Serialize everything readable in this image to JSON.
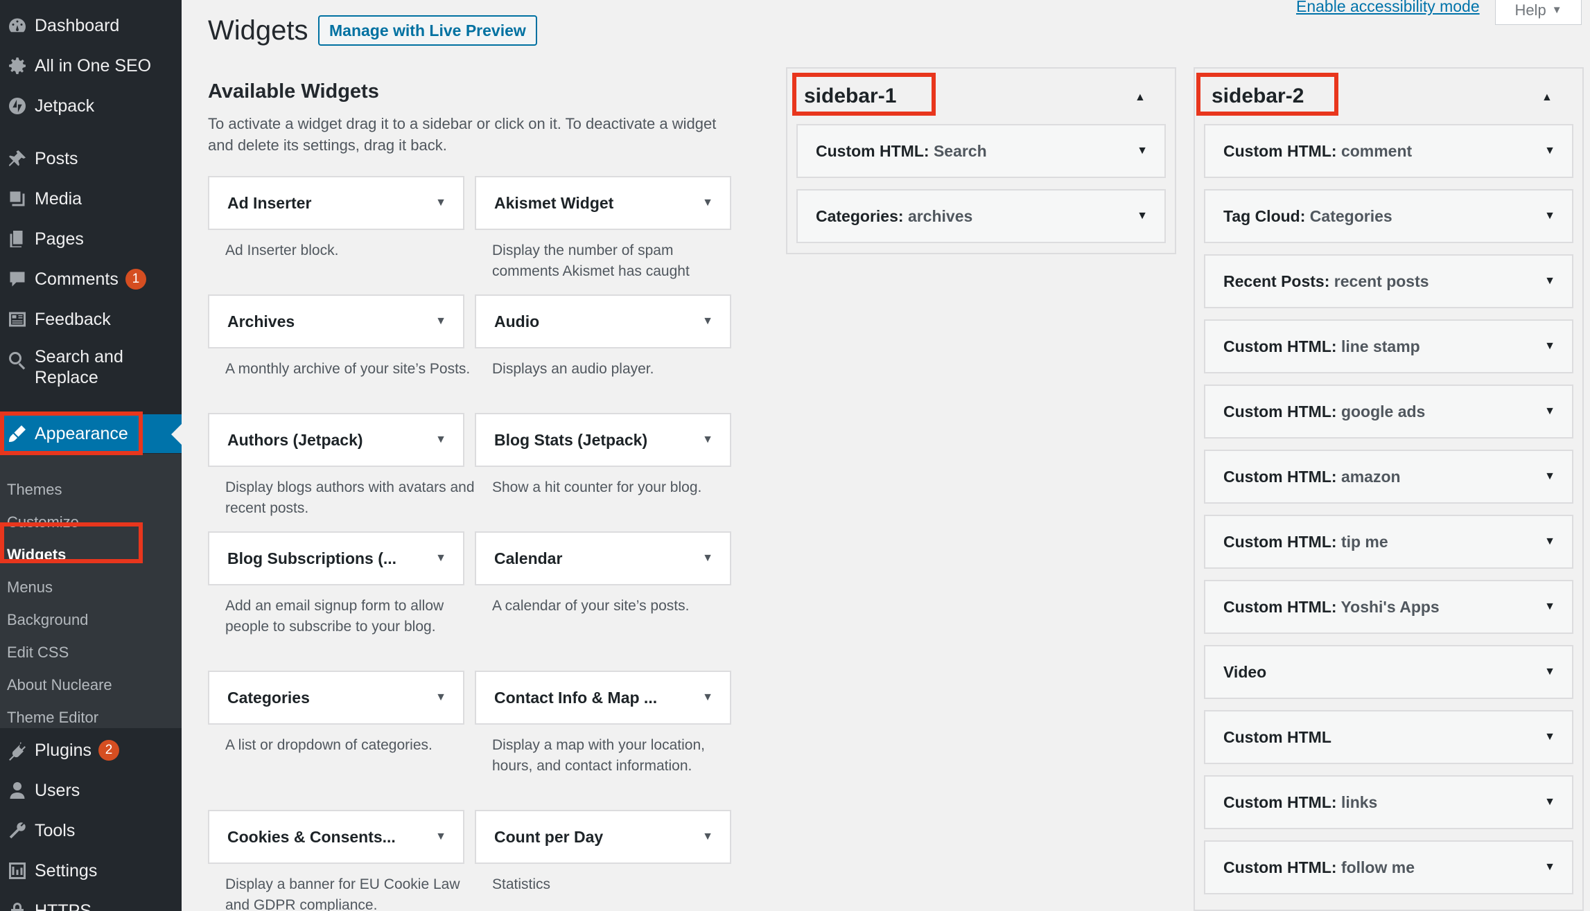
{
  "sidebar": {
    "menu": [
      {
        "label": "Dashboard",
        "icon": "dashboard-icon"
      },
      {
        "label": "All in One SEO",
        "icon": "gear-icon"
      },
      {
        "label": "Jetpack",
        "icon": "jetpack-icon"
      },
      {
        "label": "Posts",
        "icon": "pin-icon"
      },
      {
        "label": "Media",
        "icon": "media-icon"
      },
      {
        "label": "Pages",
        "icon": "pages-icon"
      },
      {
        "label": "Comments",
        "icon": "comment-icon",
        "badge": "1"
      },
      {
        "label": "Feedback",
        "icon": "feedback-icon"
      },
      {
        "label": "Search and Replace",
        "icon": "search-icon"
      },
      {
        "label": "Appearance",
        "icon": "brush-icon"
      },
      {
        "label": "Plugins",
        "icon": "plug-icon",
        "badge": "2"
      },
      {
        "label": "Users",
        "icon": "user-icon"
      },
      {
        "label": "Tools",
        "icon": "wrench-icon"
      },
      {
        "label": "Settings",
        "icon": "settings-icon"
      },
      {
        "label": "HTTPS",
        "icon": "lock-icon"
      }
    ],
    "appearance_submenu": [
      "Themes",
      "Customize",
      "Widgets",
      "Menus",
      "Background",
      "Edit CSS",
      "About Nucleare",
      "Theme Editor"
    ]
  },
  "topbar": {
    "accessibility_link": "Enable accessibility mode",
    "help_label": "Help"
  },
  "header": {
    "title": "Widgets",
    "live_preview_button": "Manage with Live Preview"
  },
  "available": {
    "title": "Available Widgets",
    "description": "To activate a widget drag it to a sidebar or click on it. To deactivate a widget and delete its settings, drag it back.",
    "widgets": [
      {
        "title": "Ad Inserter",
        "desc": "Ad Inserter block."
      },
      {
        "title": "Akismet Widget",
        "desc": "Display the number of spam comments Akismet has caught"
      },
      {
        "title": "Archives",
        "desc": "A monthly archive of your site’s Posts."
      },
      {
        "title": "Audio",
        "desc": "Displays an audio player."
      },
      {
        "title": "Authors (Jetpack)",
        "desc": "Display blogs authors with avatars and recent posts."
      },
      {
        "title": "Blog Stats (Jetpack)",
        "desc": "Show a hit counter for your blog."
      },
      {
        "title": "Blog Subscriptions (...",
        "desc": "Add an email signup form to al­low people to subscribe to your blog."
      },
      {
        "title": "Calendar",
        "desc": "A calendar of your site’s posts."
      },
      {
        "title": "Categories",
        "desc": "A list or dropdown of cate­gories."
      },
      {
        "title": "Contact Info & Map ...",
        "desc": "Display a map with your loca­tion, hours, and contact infor­mation."
      },
      {
        "title": "Cookies & Consents...",
        "desc": "Display a banner for EU Cookie Law and GDPR compliance."
      },
      {
        "title": "Count per Day",
        "desc": "Statistics"
      }
    ]
  },
  "sidebar1": {
    "title": "sidebar-1",
    "widgets": [
      {
        "type": "Custom HTML",
        "name": "Search"
      },
      {
        "type": "Categories",
        "name": "archives"
      }
    ]
  },
  "sidebar2": {
    "title": "sidebar-2",
    "widgets": [
      {
        "type": "Custom HTML",
        "name": "comment"
      },
      {
        "type": "Tag Cloud",
        "name": "Categories"
      },
      {
        "type": "Recent Posts",
        "name": "recent posts"
      },
      {
        "type": "Custom HTML",
        "name": "line stamp"
      },
      {
        "type": "Custom HTML",
        "name": "google ads"
      },
      {
        "type": "Custom HTML",
        "name": "amazon"
      },
      {
        "type": "Custom HTML",
        "name": "tip me"
      },
      {
        "type": "Custom HTML",
        "name": "Yoshi's Apps"
      },
      {
        "type": "Video",
        "name": ""
      },
      {
        "type": "Custom HTML",
        "name": ""
      },
      {
        "type": "Custom HTML",
        "name": "links"
      },
      {
        "type": "Custom HTML",
        "name": "follow me"
      }
    ]
  },
  "colors": {
    "highlight": "#e8361d",
    "admin_bg": "#23282d",
    "accent": "#0073aa"
  }
}
